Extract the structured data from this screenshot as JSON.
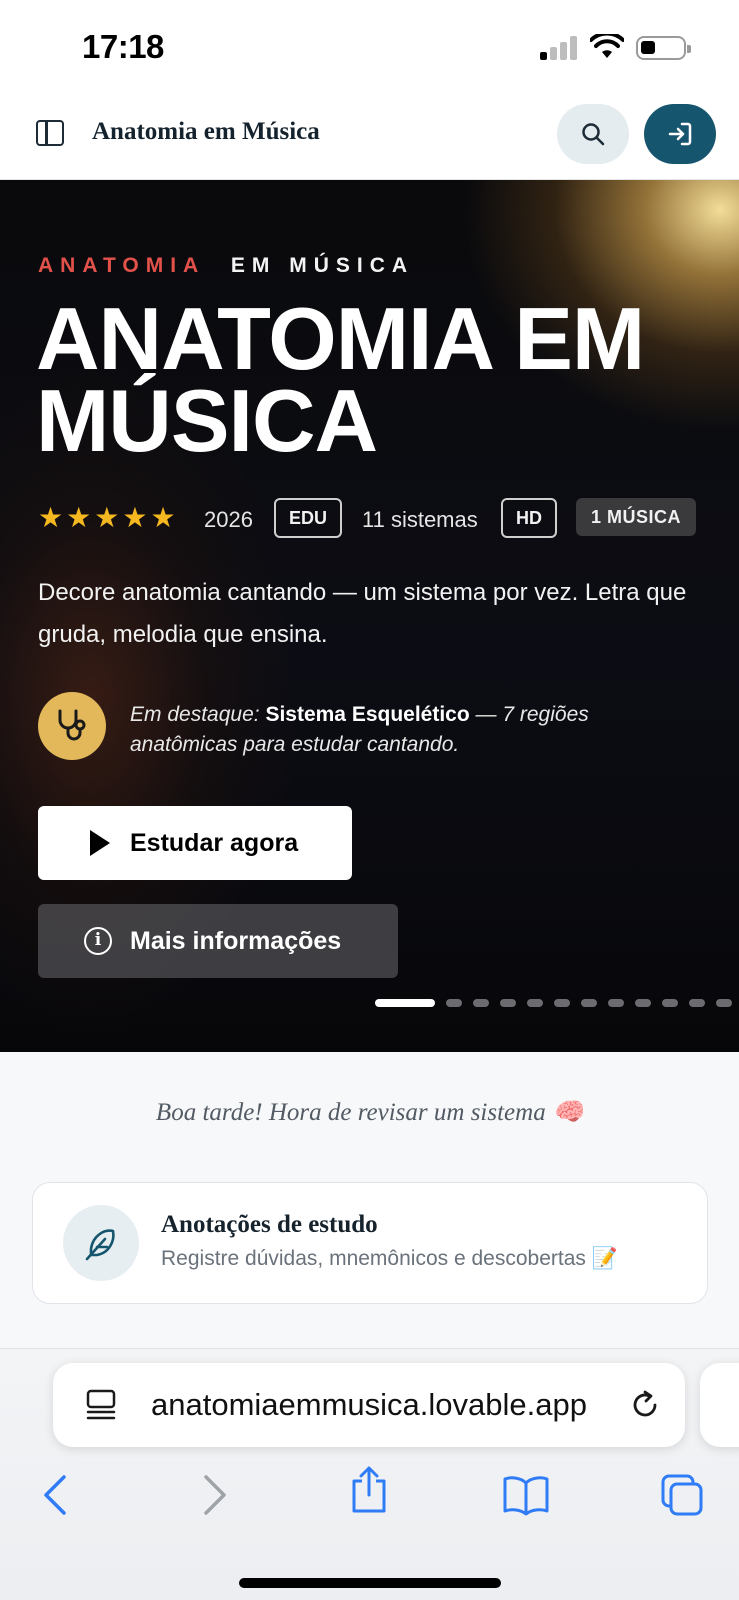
{
  "status_bar": {
    "time": "17:18"
  },
  "header": {
    "title": "Anatomia em Música"
  },
  "hero": {
    "eyebrow_red": "ANATOMIA",
    "eyebrow_white": "EM MÚSICA",
    "title": "ANATOMIA EM MÚSICA",
    "rating": 5,
    "year": "2026",
    "badge_edu": "EDU",
    "systems": "11 sistemas",
    "badge_hd": "HD",
    "badge_music": "1 MÚSICA",
    "description": "Decore anatomia cantando — um sistema por vez. Letra que gruda, melodia que ensina.",
    "featured_prefix": "Em destaque:",
    "featured_name": "Sistema Esquelético",
    "featured_suffix": "— 7 regiões anatômicas para estudar cantando.",
    "study_button": "Estudar agora",
    "info_button": "Mais informações",
    "slide_count": 12,
    "active_slide": 1,
    "colors": {
      "accent_red": "#e2524a",
      "star": "#f5b820",
      "featured_icon_bg": "#e2b85a"
    }
  },
  "content": {
    "greeting": "Boa tarde! Hora de revisar um sistema 🧠",
    "notes_card": {
      "title": "Anotações de estudo",
      "subtitle": "Registre dúvidas, mnemônicos e descobertas 📝"
    }
  },
  "browser": {
    "url": "anatomiaemmusica.lovable.app",
    "toolbar": [
      "back-icon",
      "forward-icon",
      "share-icon",
      "bookmarks-icon",
      "tabs-icon"
    ],
    "accent": "#2f7cf6"
  },
  "brand_color": "#15566e"
}
